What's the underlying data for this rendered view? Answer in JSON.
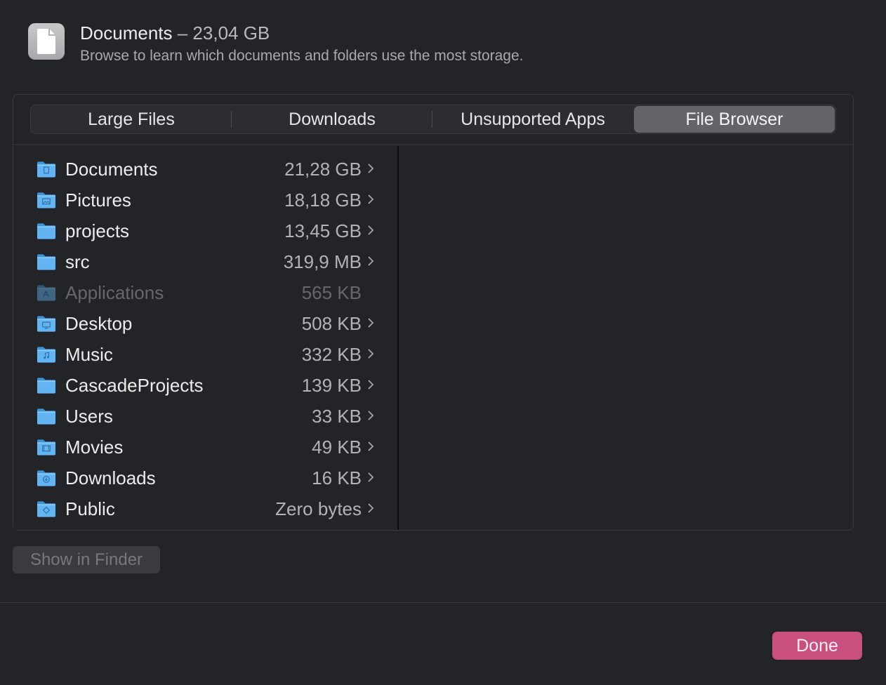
{
  "header": {
    "title": "Documents",
    "title_separator": " – ",
    "title_size": "23,04 GB",
    "subtitle": "Browse to learn which documents and folders use the most storage."
  },
  "tabs": [
    {
      "label": "Large Files",
      "active": false
    },
    {
      "label": "Downloads",
      "active": false
    },
    {
      "label": "Unsupported Apps",
      "active": false
    },
    {
      "label": "File Browser",
      "active": true
    }
  ],
  "files": [
    {
      "name": "Documents",
      "size": "21,28 GB",
      "icon": "documents-folder-icon",
      "has_chevron": true,
      "disabled": false
    },
    {
      "name": "Pictures",
      "size": "18,18 GB",
      "icon": "pictures-folder-icon",
      "has_chevron": true,
      "disabled": false
    },
    {
      "name": "projects",
      "size": "13,45 GB",
      "icon": "folder-icon",
      "has_chevron": true,
      "disabled": false
    },
    {
      "name": "src",
      "size": "319,9 MB",
      "icon": "folder-icon",
      "has_chevron": true,
      "disabled": false
    },
    {
      "name": "Applications",
      "size": "565 KB",
      "icon": "applications-folder-icon",
      "has_chevron": false,
      "disabled": true
    },
    {
      "name": "Desktop",
      "size": "508 KB",
      "icon": "desktop-folder-icon",
      "has_chevron": true,
      "disabled": false
    },
    {
      "name": "Music",
      "size": "332 KB",
      "icon": "music-folder-icon",
      "has_chevron": true,
      "disabled": false
    },
    {
      "name": "CascadeProjects",
      "size": "139 KB",
      "icon": "folder-icon",
      "has_chevron": true,
      "disabled": false
    },
    {
      "name": "Users",
      "size": "33 KB",
      "icon": "folder-icon",
      "has_chevron": true,
      "disabled": false
    },
    {
      "name": "Movies",
      "size": "49 KB",
      "icon": "movies-folder-icon",
      "has_chevron": true,
      "disabled": false
    },
    {
      "name": "Downloads",
      "size": "16 KB",
      "icon": "downloads-folder-icon",
      "has_chevron": true,
      "disabled": false
    },
    {
      "name": "Public",
      "size": "Zero bytes",
      "icon": "public-folder-icon",
      "has_chevron": true,
      "disabled": false
    }
  ],
  "buttons": {
    "show_in_finder": "Show in Finder",
    "done": "Done"
  },
  "colors": {
    "accent": "#c84f7e",
    "folder_blue": "#5fb3f0"
  },
  "icons": {
    "header": "document-icon",
    "chevron": "chevron-right-icon"
  }
}
